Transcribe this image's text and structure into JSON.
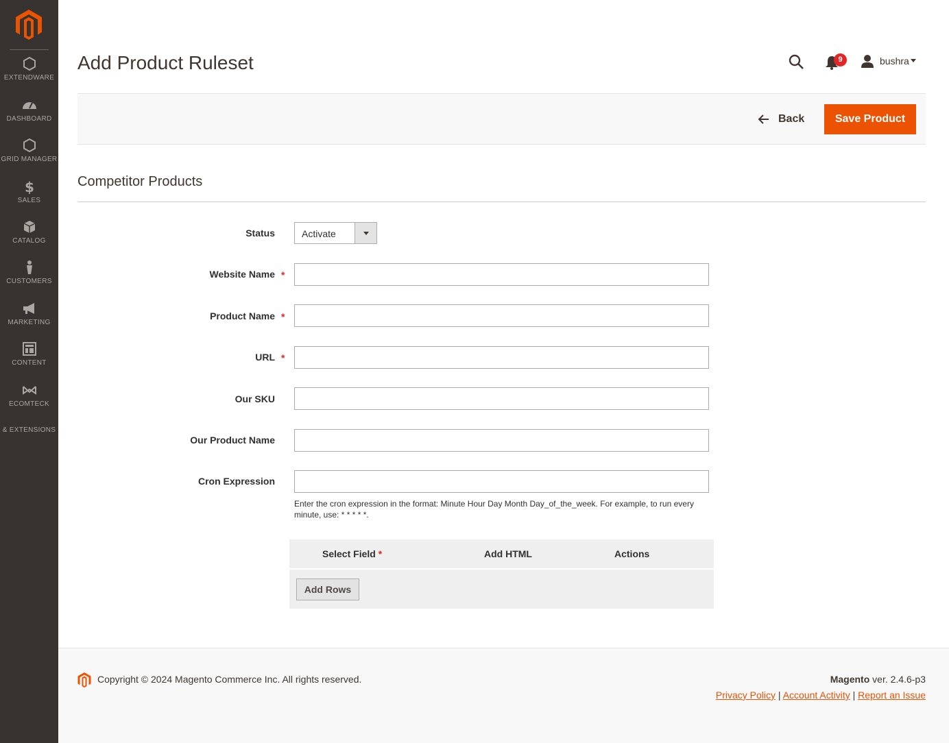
{
  "sidebar": {
    "logo": "magento-logo",
    "items": [
      {
        "label": "EXTENDWARE",
        "icon": "hexagon-icon"
      },
      {
        "label": "DASHBOARD",
        "icon": "dashboard-icon"
      },
      {
        "label": "GRID MANAGER",
        "icon": "hexagon-icon"
      },
      {
        "label": "SALES",
        "icon": "dollar-icon"
      },
      {
        "label": "CATALOG",
        "icon": "box-icon"
      },
      {
        "label": "CUSTOMERS",
        "icon": "person-icon"
      },
      {
        "label": "MARKETING",
        "icon": "megaphone-icon"
      },
      {
        "label": "CONTENT",
        "icon": "layout-icon"
      },
      {
        "label": "ECOMTECK",
        "icon": "ecomteck-icon"
      }
    ],
    "cut_item": "& EXTENSIONS"
  },
  "header": {
    "title": "Add Product Ruleset",
    "notifications_count": "9",
    "user_name": "bushra"
  },
  "actions": {
    "back_label": "Back",
    "save_label": "Save Product"
  },
  "section": {
    "title": "Competitor Products"
  },
  "form": {
    "status_label": "Status",
    "status_value": "Activate",
    "website_name_label": "Website Name",
    "website_name_value": "",
    "product_name_label": "Product Name",
    "product_name_value": "",
    "url_label": "URL",
    "url_value": "",
    "our_sku_label": "Our SKU",
    "our_sku_value": "",
    "our_product_name_label": "Our Product Name",
    "our_product_name_value": "",
    "cron_label": "Cron Expression",
    "cron_value": "",
    "cron_note": "Enter the cron expression in the format: Minute Hour Day Month Day_of_the_week. For example, to run every minute, use: * * * * *.",
    "required_mark": "*"
  },
  "rows_table": {
    "col_select_field": "Select Field",
    "col_add_html": "Add HTML",
    "col_actions": "Actions",
    "add_rows_label": "Add Rows"
  },
  "footer": {
    "copyright": "Copyright © 2024 Magento Commerce Inc. All rights reserved.",
    "brand": "Magento",
    "version": " ver. 2.4.6-p3",
    "privacy": "Privacy Policy",
    "activity": " Account Activity",
    "report": "Report an Issue",
    "sep": "|"
  },
  "colors": {
    "accent": "#eb5202",
    "sidebar_bg": "#373330",
    "badge": "#e22626"
  }
}
